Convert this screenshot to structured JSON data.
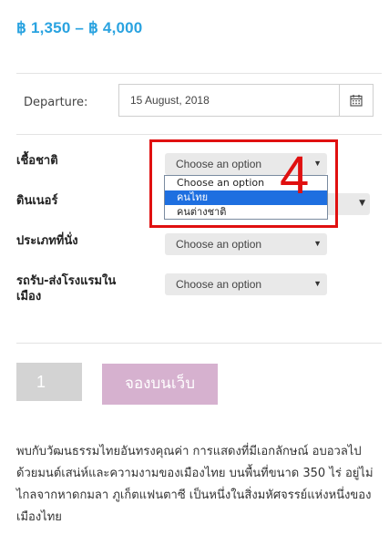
{
  "price_range": "฿ 1,350 – ฿ 4,000",
  "departure": {
    "label": "Departure:",
    "value": "15 August, 2018",
    "calendar_icon": "calendar-icon"
  },
  "fields": {
    "nationality": {
      "label": "เชื้อชาติ",
      "value": "Choose an option"
    },
    "dinner": {
      "label": "ดินเนอร์"
    },
    "seat_type": {
      "label": "ประเภทที่นั่ง",
      "value": "Choose an option"
    },
    "transfer": {
      "label": "รถรับ-ส่งโรงแรมใน เมือง",
      "value": "Choose an option"
    }
  },
  "dropdown": {
    "options": [
      "Choose an option",
      "คนไทย",
      "คนต่างชาติ"
    ],
    "highlighted_index": 1,
    "highlight_color": "#1e6fe0"
  },
  "annotation": {
    "number": "4",
    "color": "#e01010"
  },
  "quantity": "1",
  "book_button": "จองบนเว็บ",
  "description": "พบกับวัฒนธรรมไทยอันทรงคุณค่า การแสดงที่มีเอกลักษณ์ อบอวลไปด้วยมนต์เสน่ห์และความงามของเมืองไทย บนพื้นที่ขนาด 350 ไร่ อยู่ไม่ไกลจากหาดกมลา ภูเก็ตแฟนตาซี เป็นหนึ่งในสิ่งมหัศจรรย์แห่งหนึ่งของเมืองไทย",
  "colors": {
    "price": "#2aa3e0",
    "book_button_bg": "#d6b1cf",
    "qty_bg": "#d3d3d3"
  }
}
